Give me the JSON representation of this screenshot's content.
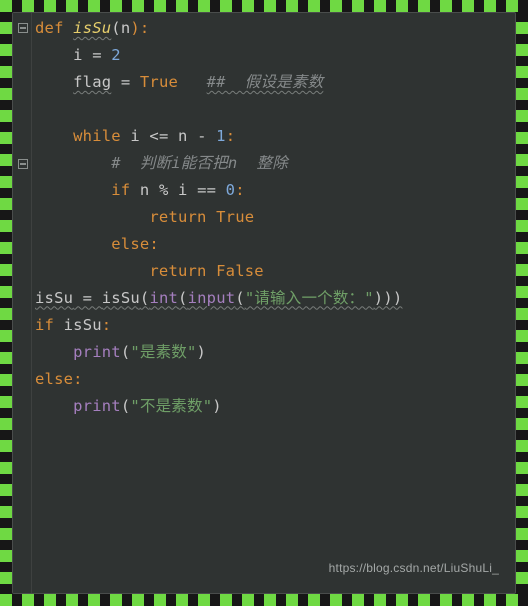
{
  "code": {
    "l1_def": "def",
    "l1_fname": "isSu",
    "l1_open": "(",
    "l1_param": "n",
    "l1_close_col": "):",
    "l2_ind": "    ",
    "l2_var": "i",
    "l2_eq": " = ",
    "l2_val": "2",
    "l3_ind": "    ",
    "l3_var": "flag",
    "l3_eq": " = ",
    "l3_val": "True",
    "l3_sp": "   ",
    "l3_cmt": "##  假设是素数",
    "l5_ind": "    ",
    "l5_while": "while",
    "l5_expr_a": " i <= n - ",
    "l5_one": "1",
    "l5_col": ":",
    "l6_ind": "        ",
    "l6_cmt": "#  判断i能否把n  整除",
    "l7_ind": "        ",
    "l7_if": "if",
    "l7_expr_a": " n % i == ",
    "l7_zero": "0",
    "l7_col": ":",
    "l8_ind": "            ",
    "l8_ret": "return",
    "l8_sp": " ",
    "l8_val": "True",
    "l9_ind": "        ",
    "l9_else": "else",
    "l9_col": ":",
    "l10_ind": "            ",
    "l10_ret": "return",
    "l10_sp": " ",
    "l10_val": "False",
    "l11_var": "isSu",
    "l11_eq": " = ",
    "l11_call_fn": "isSu",
    "l11_open": "(",
    "l11_int": "int",
    "l11_open2": "(",
    "l11_input": "input",
    "l11_open3": "(",
    "l11_str": "\"请输入一个数：\"",
    "l11_close": ")))",
    "l12_if": "if",
    "l12_sp": " ",
    "l12_var": "isSu",
    "l12_col": ":",
    "l13_ind": "    ",
    "l13_print": "print",
    "l13_open": "(",
    "l13_str": "\"是素数\"",
    "l13_close": ")",
    "l14_else": "else",
    "l14_col": ":",
    "l15_ind": "    ",
    "l15_print": "print",
    "l15_open": "(",
    "l15_str": "\"不是素数\"",
    "l15_close": ")"
  },
  "watermark": "https://blog.csdn.net/LiuShuLi_"
}
